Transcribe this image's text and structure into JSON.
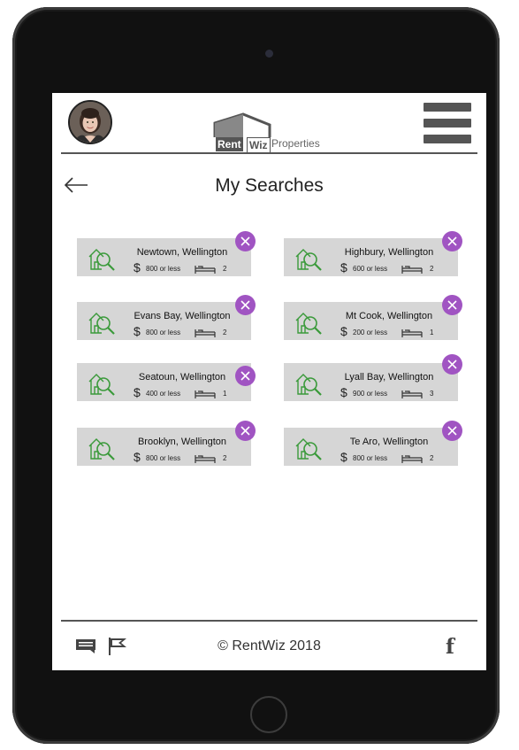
{
  "header": {
    "logo": {
      "rent": "Rent",
      "wiz": "Wiz",
      "properties": "Properties"
    }
  },
  "page": {
    "title": "My Searches"
  },
  "searches": [
    {
      "location": "Newtown, Wellington",
      "price": "800 or less",
      "beds": "2"
    },
    {
      "location": "Highbury, Wellington",
      "price": "600 or less",
      "beds": "2"
    },
    {
      "location": "Evans Bay, Wellington",
      "price": "800 or less",
      "beds": "2"
    },
    {
      "location": "Mt Cook, Wellington",
      "price": "200 or less",
      "beds": "1"
    },
    {
      "location": "Seatoun, Wellington",
      "price": "400 or less",
      "beds": "1"
    },
    {
      "location": "Lyall Bay, Wellington",
      "price": "900 or less",
      "beds": "3"
    },
    {
      "location": "Brooklyn, Wellington",
      "price": "800 or less",
      "beds": "2"
    },
    {
      "location": "Te Aro, Wellington",
      "price": "800 or less",
      "beds": "2"
    }
  ],
  "currency_symbol": "$",
  "footer": {
    "copyright": "© RentWiz 2018",
    "facebook_glyph": "f"
  },
  "colors": {
    "accent": "#a054c2",
    "icon_green": "#3a9a3a",
    "card_bg": "#d6d6d6",
    "rule": "#555555"
  },
  "icons": [
    "house-search-icon",
    "bed-icon",
    "close-icon",
    "back-arrow-icon",
    "chat-icon",
    "flag-icon",
    "facebook-icon",
    "menu-icon"
  ]
}
